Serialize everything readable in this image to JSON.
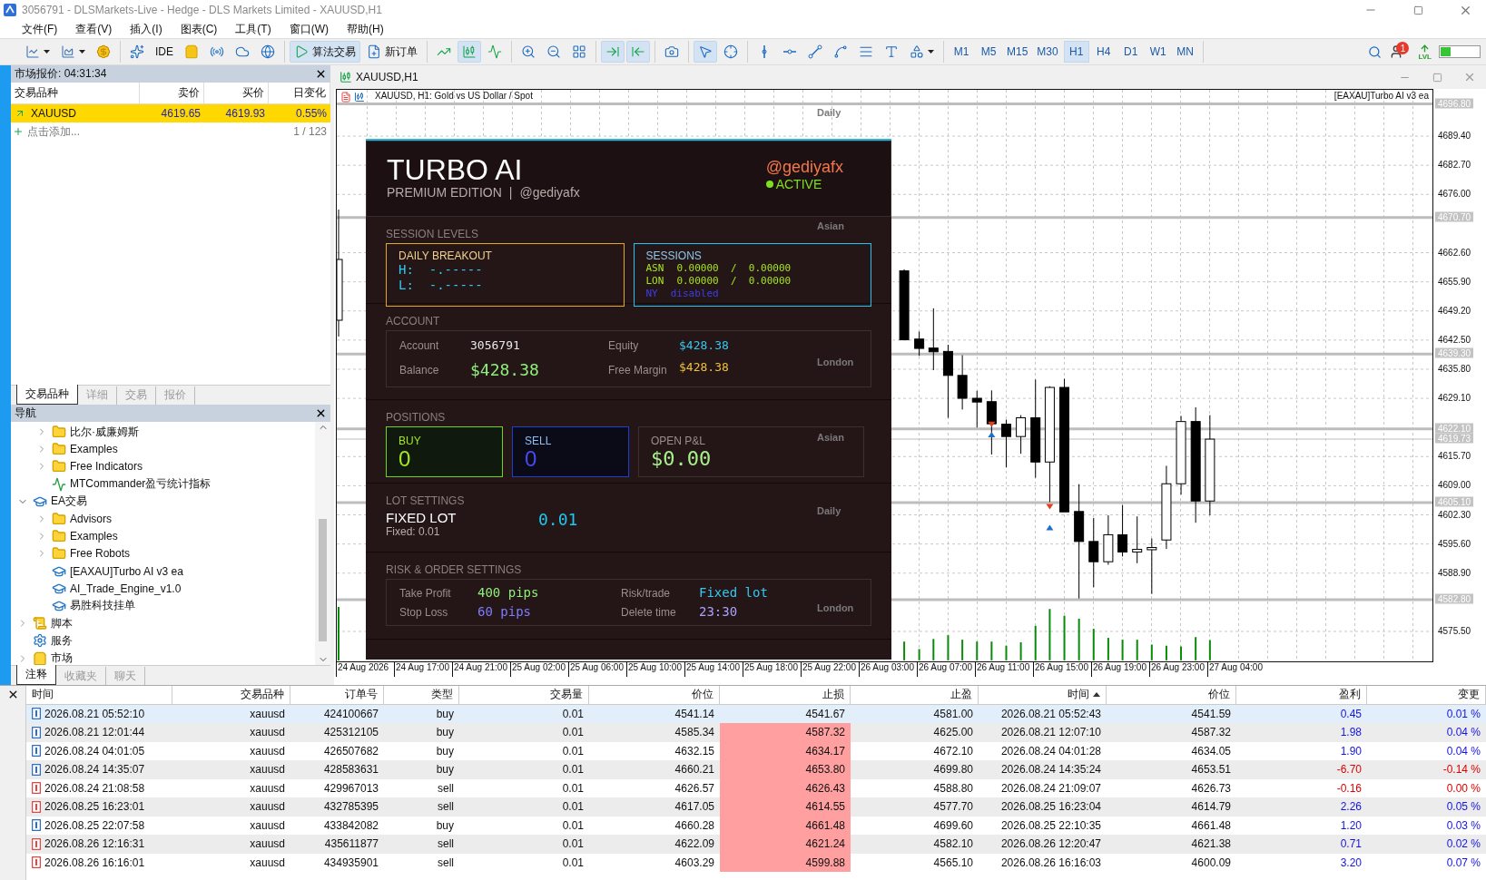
{
  "window": {
    "title": "3056791 - DLSMarkets-Live - Hedge - DLS Markets Limited - XAUUSD,H1"
  },
  "menu": [
    "文件(F)",
    "查看(V)",
    "插入(I)",
    "图表(C)",
    "工具(T)",
    "窗口(W)",
    "帮助(H)"
  ],
  "toolbar": {
    "groups": [
      [
        {
          "kind": "linechart",
          "on": false
        },
        {
          "kind": "template",
          "on": false
        },
        {
          "kind": "dollar",
          "on": false
        }
      ],
      [
        {
          "kind": "sparkle",
          "on": false
        },
        {
          "kind": "ide",
          "label": "IDE",
          "on": false
        },
        {
          "kind": "bag",
          "on": false
        },
        {
          "kind": "signal",
          "on": false
        },
        {
          "kind": "cloud",
          "on": false
        },
        {
          "kind": "vps",
          "on": false
        }
      ],
      [
        {
          "kind": "algo",
          "label": "算法交易",
          "on": true
        },
        {
          "kind": "order",
          "label": "新订单",
          "on": false
        }
      ],
      [
        {
          "kind": "bars",
          "on": false
        },
        {
          "kind": "candles",
          "on": true
        },
        {
          "kind": "line",
          "on": false
        }
      ],
      [
        {
          "kind": "zoomin",
          "on": false
        },
        {
          "kind": "zoomout",
          "on": false
        },
        {
          "kind": "tile",
          "on": false
        }
      ],
      [
        {
          "kind": "autoscroll",
          "on": true
        },
        {
          "kind": "shift",
          "on": true
        }
      ],
      [
        {
          "kind": "screenshot",
          "on": false
        }
      ],
      [
        {
          "kind": "cursor",
          "on": true
        },
        {
          "kind": "crosshair",
          "on": false
        }
      ],
      [
        {
          "kind": "vline",
          "on": false
        },
        {
          "kind": "hline",
          "on": false
        },
        {
          "kind": "trend",
          "on": false
        },
        {
          "kind": "channel",
          "on": false
        },
        {
          "kind": "fibo",
          "on": false
        },
        {
          "kind": "text",
          "on": false
        },
        {
          "kind": "shapes",
          "on": false
        }
      ]
    ],
    "timeframes": [
      {
        "label": "M1",
        "selected": false
      },
      {
        "label": "M5",
        "selected": false
      },
      {
        "label": "M15",
        "selected": false
      },
      {
        "label": "M30",
        "selected": false
      },
      {
        "label": "H1",
        "selected": true
      },
      {
        "label": "H4",
        "selected": false
      },
      {
        "label": "D1",
        "selected": false
      },
      {
        "label": "W1",
        "selected": false
      },
      {
        "label": "MN",
        "selected": false
      }
    ],
    "notification_count": "1",
    "level_badge": "LVL"
  },
  "market_watch": {
    "title": "市场报价: 04:31:34",
    "columns": [
      "交易品种",
      "卖价",
      "买价",
      "日变化"
    ],
    "rows": [
      {
        "symbol": "XAUUSD",
        "bid": "4619.65",
        "ask": "4619.93",
        "change": "0.55%",
        "selected": true
      }
    ],
    "add_label": "点击添加...",
    "count": "1 / 123",
    "tabs": [
      {
        "label": "交易品种",
        "selected": true
      },
      {
        "label": "详细",
        "selected": false
      },
      {
        "label": "交易",
        "selected": false
      },
      {
        "label": "报价",
        "selected": false
      }
    ]
  },
  "navigator": {
    "title": "导航",
    "scrolled_children": [
      {
        "label": "比尔·威廉姆斯",
        "kind": "folder",
        "expanded": false
      },
      {
        "label": "Examples",
        "kind": "folder",
        "expanded": false
      },
      {
        "label": "Free Indicators",
        "kind": "folder",
        "expanded": false
      },
      {
        "label": "MTCommander盈亏统计指标",
        "kind": "indicator"
      }
    ],
    "tree": [
      {
        "label": "EA交易",
        "kind": "expert",
        "expanded": true,
        "children": [
          {
            "label": "Advisors",
            "kind": "folder",
            "expanded": false
          },
          {
            "label": "Examples",
            "kind": "folder",
            "expanded": false
          },
          {
            "label": "Free Robots",
            "kind": "folder",
            "expanded": false
          },
          {
            "label": "[EAXAU]Turbo AI v3 ea",
            "kind": "expert"
          },
          {
            "label": "AI_Trade_Engine_v1.0",
            "kind": "expert"
          },
          {
            "label": "易胜科技挂单",
            "kind": "expert"
          }
        ]
      },
      {
        "label": "脚本",
        "kind": "script",
        "expanded": false
      },
      {
        "label": "服务",
        "kind": "service"
      },
      {
        "label": "市场",
        "kind": "market",
        "expanded": false
      }
    ],
    "tabs": [
      {
        "label": "注释",
        "selected": true
      },
      {
        "label": "收藏夹",
        "selected": false
      },
      {
        "label": "聊天",
        "selected": false
      }
    ]
  },
  "chart": {
    "tab": "XAUUSD,H1",
    "title": "XAUUSD, H1:  Gold vs US Dollar / Spot",
    "expert": "[EAXAU]Turbo AI v3 ea",
    "price_ticks": [
      "4689.40",
      "4682.70",
      "4676.00",
      "4662.60",
      "4655.90",
      "4649.20",
      "4642.50",
      "4635.80",
      "4629.10",
      "4615.70",
      "4609.00",
      "4602.30",
      "4595.60",
      "4588.90",
      "4575.50"
    ],
    "levels": [
      {
        "kind": "session",
        "price": "4696.80",
        "session": "Daily"
      },
      {
        "kind": "session",
        "price": "4670.70",
        "session": "Asian"
      },
      {
        "kind": "session",
        "price": "4639.30",
        "session": "London"
      },
      {
        "kind": "session",
        "price": "4622.10",
        "session": "Asian"
      },
      {
        "kind": "bid",
        "price": "4619.73"
      },
      {
        "kind": "session",
        "price": "4605.10",
        "session": "Daily"
      },
      {
        "kind": "session",
        "price": "4582.80",
        "session": "London"
      }
    ],
    "time_labels": [
      "24 Aug 2026",
      "24 Aug 17:00",
      "24 Aug 21:00",
      "25 Aug 02:00",
      "25 Aug 06:00",
      "25 Aug 10:00",
      "25 Aug 14:00",
      "25 Aug 18:00",
      "25 Aug 22:00",
      "26 Aug 03:00",
      "26 Aug 07:00",
      "26 Aug 11:00",
      "26 Aug 15:00",
      "26 Aug 19:00",
      "26 Aug 23:00",
      "27 Aug 04:00"
    ]
  },
  "ea_panel": {
    "title": "TURBO AI",
    "edition": "PREMIUM EDITION",
    "separator": "|",
    "handle": "@gediyafx",
    "author": "@gediyafx",
    "status": "ACTIVE",
    "session_levels": {
      "heading": "SESSION LEVELS",
      "breakout_title": "DAILY BREAKOUT",
      "high": "H:  -.-----",
      "low": "L:  -.-----",
      "sessions_title": "SESSIONS",
      "sessions": [
        {
          "name": "ASN",
          "value": "0.00000  /  0.00000",
          "enabled": true
        },
        {
          "name": "LON",
          "value": "0.00000  /  0.00000",
          "enabled": true
        },
        {
          "name": "NY",
          "value": "disabled",
          "enabled": false
        }
      ]
    },
    "account": {
      "heading": "ACCOUNT",
      "fields": [
        {
          "label": "Account",
          "value": "3056791",
          "kind": "plain"
        },
        {
          "label": "Equity",
          "value": "$428.38",
          "kind": "equity"
        },
        {
          "label": "Balance",
          "value": "$428.38",
          "kind": "balance"
        },
        {
          "label": "Free Margin",
          "value": "$428.38",
          "kind": "margin"
        }
      ]
    },
    "positions": {
      "heading": "POSITIONS",
      "buy_label": "BUY",
      "buy": "0",
      "sell_label": "SELL",
      "sell": "0",
      "pnl_label": "OPEN P&L",
      "pnl": "$0.00"
    },
    "lot": {
      "heading": "LOT SETTINGS",
      "mode": "FIXED LOT",
      "note": "Fixed: 0.01",
      "value": "0.01"
    },
    "risk": {
      "heading": "RISK & ORDER SETTINGS",
      "fields": [
        {
          "label": "Take Profit",
          "value": "400 pips",
          "kind": "tp"
        },
        {
          "label": "Risk/trade",
          "value": "Fixed lot",
          "kind": "risk"
        },
        {
          "label": "Stop Loss",
          "value": "60 pips",
          "kind": "sl"
        },
        {
          "label": "Delete time",
          "value": "23:30",
          "kind": "time"
        }
      ]
    }
  },
  "trades": {
    "columns": [
      {
        "label": "时间",
        "sorted": false
      },
      {
        "label": "交易品种",
        "sorted": false
      },
      {
        "label": "订单号",
        "sorted": false
      },
      {
        "label": "类型",
        "sorted": false
      },
      {
        "label": "交易量",
        "sorted": false
      },
      {
        "label": "价位",
        "sorted": false
      },
      {
        "label": "止损",
        "sorted": false
      },
      {
        "label": "止盈",
        "sorted": false
      },
      {
        "label": "时间",
        "sorted": true
      },
      {
        "label": "价位",
        "sorted": false
      },
      {
        "label": "盈利",
        "sorted": false
      },
      {
        "label": "变更",
        "sorted": false
      }
    ],
    "rows": [
      {
        "color": "#2f6fc7",
        "selected": true,
        "sl_flag": false,
        "loss": false,
        "cells": [
          "2026.08.21 05:52:10",
          "xauusd",
          "424100667",
          "buy",
          "0.01",
          "4541.14",
          "4541.67",
          "4581.00",
          "2026.08.21 05:52:43",
          "4541.59",
          "0.45",
          "0.01 %"
        ]
      },
      {
        "color": "#2f6fc7",
        "selected": false,
        "sl_flag": true,
        "loss": false,
        "cells": [
          "2026.08.21 12:01:44",
          "xauusd",
          "425312105",
          "buy",
          "0.01",
          "4585.34",
          "4587.32",
          "4625.00",
          "2026.08.21 12:07:10",
          "4587.32",
          "1.98",
          "0.04 %"
        ]
      },
      {
        "color": "#2f6fc7",
        "selected": false,
        "sl_flag": true,
        "loss": false,
        "cells": [
          "2026.08.24 04:01:05",
          "xauusd",
          "426507682",
          "buy",
          "0.01",
          "4632.15",
          "4634.17",
          "4672.10",
          "2026.08.24 04:01:28",
          "4634.05",
          "1.90",
          "0.04 %"
        ]
      },
      {
        "color": "#2f6fc7",
        "selected": false,
        "sl_flag": true,
        "loss": true,
        "cells": [
          "2026.08.24 14:35:07",
          "xauusd",
          "428583631",
          "buy",
          "0.01",
          "4660.21",
          "4653.80",
          "4699.80",
          "2026.08.24 14:35:24",
          "4653.51",
          "-6.70",
          "-0.14 %"
        ]
      },
      {
        "color": "#e04848",
        "selected": false,
        "sl_flag": true,
        "loss": true,
        "cells": [
          "2026.08.24 21:08:58",
          "xauusd",
          "429967013",
          "sell",
          "0.01",
          "4626.57",
          "4626.43",
          "4588.80",
          "2026.08.24 21:09:07",
          "4626.73",
          "-0.16",
          "0.00 %"
        ]
      },
      {
        "color": "#e04848",
        "selected": false,
        "sl_flag": true,
        "loss": false,
        "cells": [
          "2026.08.25 16:23:01",
          "xauusd",
          "432785395",
          "sell",
          "0.01",
          "4617.05",
          "4614.55",
          "4577.70",
          "2026.08.25 16:23:04",
          "4614.79",
          "2.26",
          "0.05 %"
        ]
      },
      {
        "color": "#2f6fc7",
        "selected": false,
        "sl_flag": true,
        "loss": false,
        "cells": [
          "2026.08.25 22:07:58",
          "xauusd",
          "433842082",
          "buy",
          "0.01",
          "4660.28",
          "4661.48",
          "4699.60",
          "2026.08.25 22:10:35",
          "4661.48",
          "1.20",
          "0.03 %"
        ]
      },
      {
        "color": "#e04848",
        "selected": false,
        "sl_flag": true,
        "loss": false,
        "cells": [
          "2026.08.26 12:16:31",
          "xauusd",
          "435611877",
          "sell",
          "0.01",
          "4622.09",
          "4621.24",
          "4582.10",
          "2026.08.26 12:20:47",
          "4621.38",
          "0.71",
          "0.02 %"
        ]
      },
      {
        "color": "#e04848",
        "selected": false,
        "sl_flag": true,
        "loss": false,
        "cells": [
          "2026.08.26 16:16:01",
          "xauusd",
          "434935901",
          "sell",
          "0.01",
          "4603.29",
          "4599.88",
          "4565.10",
          "2026.08.26 16:16:03",
          "4600.09",
          "3.20",
          "0.07 %"
        ]
      }
    ]
  }
}
